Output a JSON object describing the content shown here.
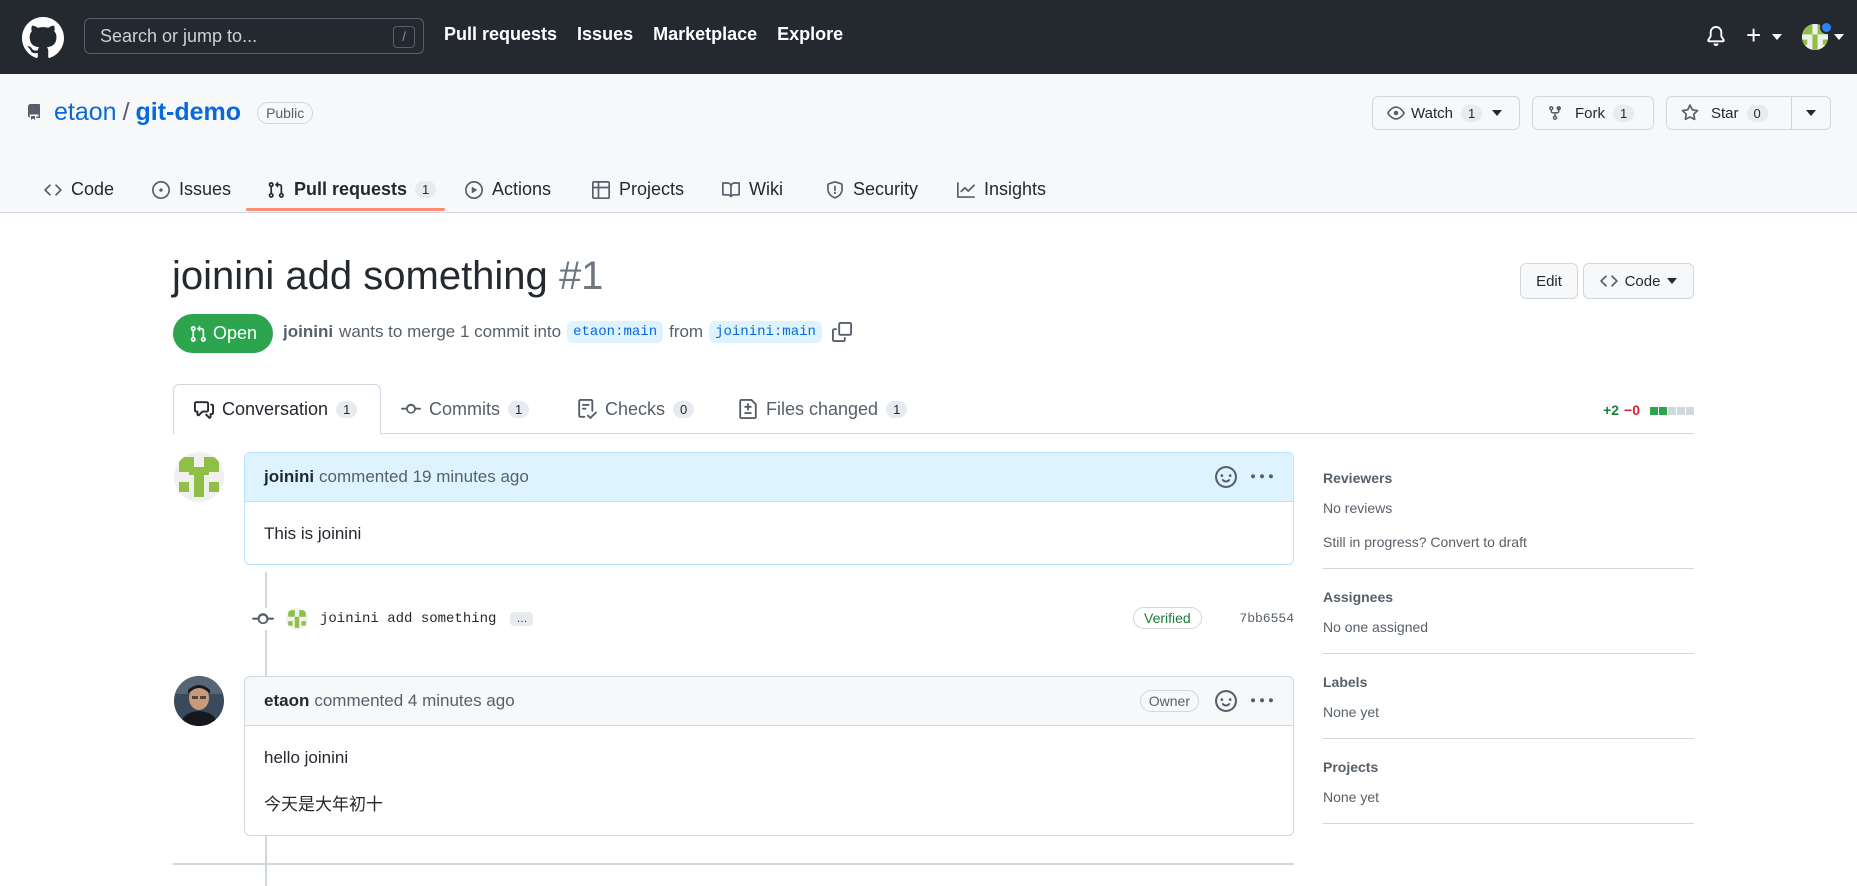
{
  "header": {
    "search_placeholder": "Search or jump to...",
    "search_shortcut": "/",
    "nav": [
      "Pull requests",
      "Issues",
      "Marketplace",
      "Explore"
    ],
    "plus_label": "+"
  },
  "repo": {
    "owner": "etaon",
    "separator": "/",
    "name": "git-demo",
    "visibility": "Public",
    "watch": {
      "label": "Watch",
      "count": "1"
    },
    "fork": {
      "label": "Fork",
      "count": "1"
    },
    "star": {
      "label": "Star",
      "count": "0"
    },
    "tabs": [
      {
        "label": "Code"
      },
      {
        "label": "Issues"
      },
      {
        "label": "Pull requests",
        "count": "1"
      },
      {
        "label": "Actions"
      },
      {
        "label": "Projects"
      },
      {
        "label": "Wiki"
      },
      {
        "label": "Security"
      },
      {
        "label": "Insights"
      }
    ]
  },
  "pr": {
    "title": "joinini add something",
    "number": "#1",
    "edit_label": "Edit",
    "code_label": "Code",
    "state": "Open",
    "author": "joinini",
    "merge_text_1": "wants to merge 1 commit into",
    "base_branch": "etaon:main",
    "merge_text_2": "from",
    "head_branch": "joinini:main",
    "tabs": [
      {
        "label": "Conversation",
        "count": "1"
      },
      {
        "label": "Commits",
        "count": "1"
      },
      {
        "label": "Checks",
        "count": "0"
      },
      {
        "label": "Files changed",
        "count": "1"
      }
    ],
    "diffstat": {
      "additions": "+2",
      "deletions": "−0"
    }
  },
  "timeline": {
    "comment1": {
      "author": "joinini",
      "meta": "commented 19 minutes ago",
      "body": "This is joinini"
    },
    "commit": {
      "message": "joinini add something",
      "more": "…",
      "verified": "Verified",
      "sha": "7bb6554"
    },
    "comment2": {
      "author": "etaon",
      "meta": "commented 4 minutes ago",
      "badge": "Owner",
      "body_1": "hello joinini",
      "body_2": "今天是大年初十"
    }
  },
  "sidebar": {
    "reviewers": {
      "title": "Reviewers",
      "value": "No reviews",
      "extra": "Still in progress? Convert to draft"
    },
    "assignees": {
      "title": "Assignees",
      "value": "No one assigned"
    },
    "labels": {
      "title": "Labels",
      "value": "None yet"
    },
    "projects": {
      "title": "Projects",
      "value": "None yet"
    }
  },
  "colors": {
    "header_bg": "#24292f",
    "open_green": "#2da44e",
    "link_blue": "#0969da",
    "tab_underline": "#fd8c73",
    "comment_head_blue": "#ddf4ff"
  }
}
